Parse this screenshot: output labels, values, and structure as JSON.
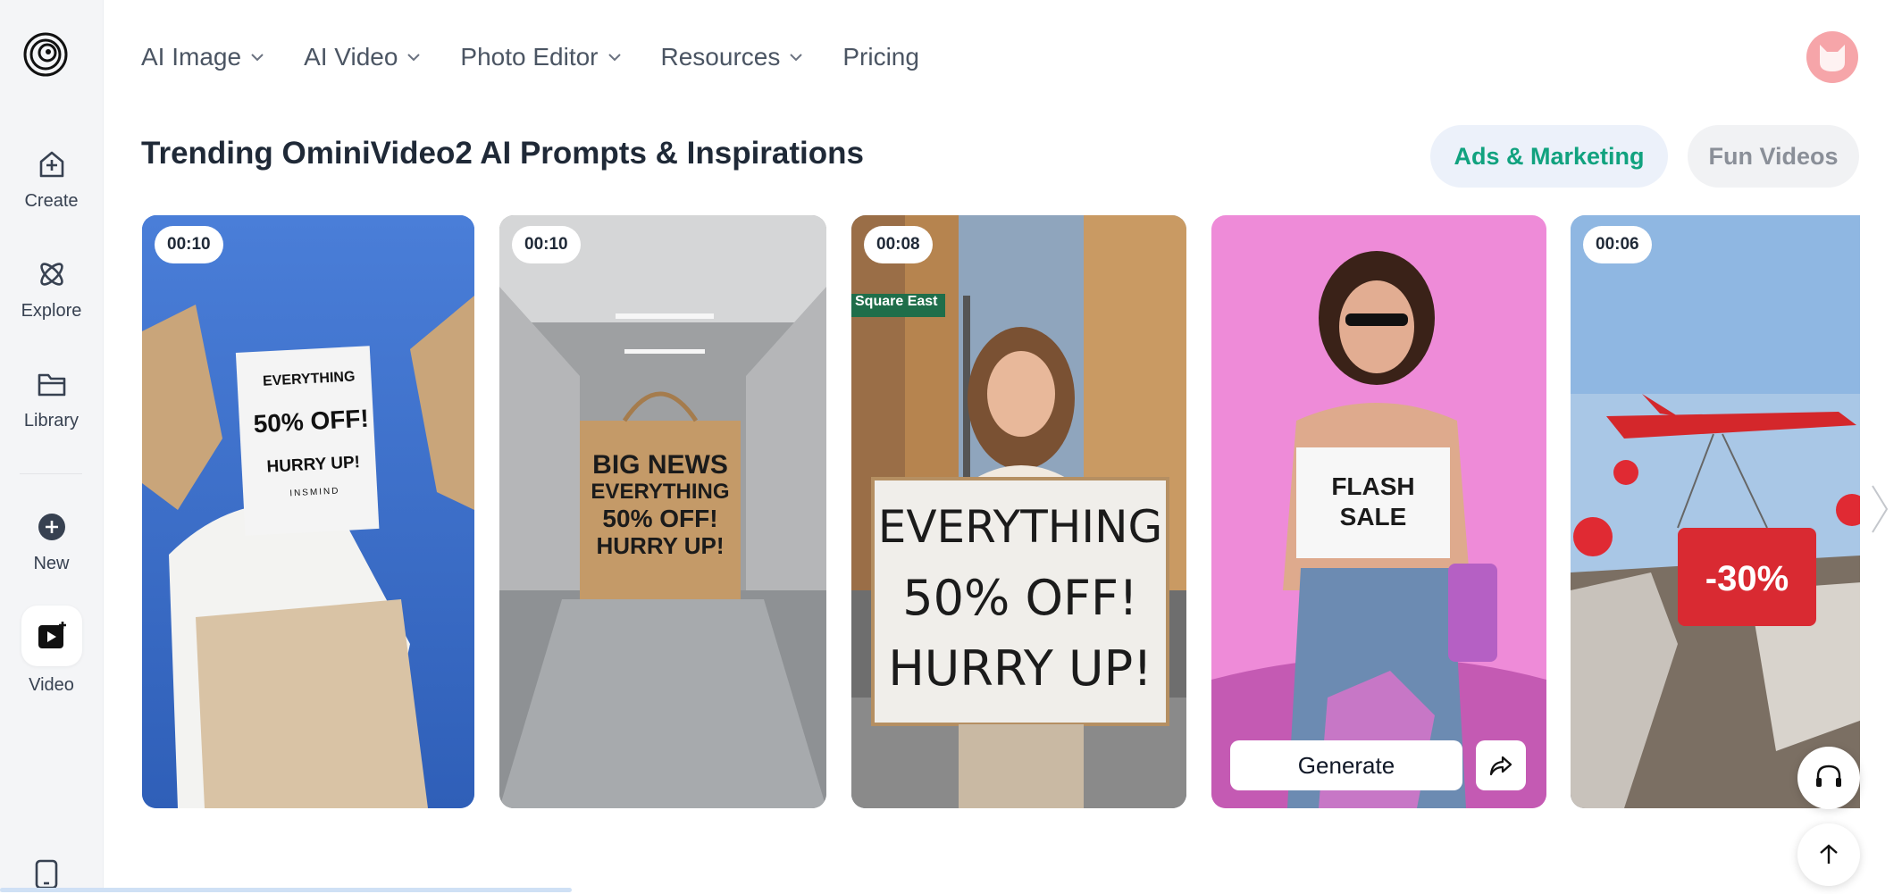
{
  "nav": {
    "items": [
      {
        "label": "AI Image",
        "has_dropdown": true
      },
      {
        "label": "AI Video",
        "has_dropdown": true
      },
      {
        "label": "Photo Editor",
        "has_dropdown": true
      },
      {
        "label": "Resources",
        "has_dropdown": true
      },
      {
        "label": "Pricing",
        "has_dropdown": false
      }
    ]
  },
  "sidebar": {
    "logo_icon": "spiral-logo-icon",
    "items": [
      {
        "label": "Create",
        "icon": "create-icon"
      },
      {
        "label": "Explore",
        "icon": "explore-icon"
      },
      {
        "label": "Library",
        "icon": "folder-icon"
      },
      {
        "label": "New",
        "icon": "plus-circle-icon"
      },
      {
        "label": "Video",
        "icon": "video-icon",
        "active": true
      }
    ],
    "bottom_icon": "mobile-icon"
  },
  "header": {
    "title": "Trending OminiVideo2 AI Prompts & Inspirations",
    "tabs": [
      {
        "label": "Ads & Marketing",
        "active": true
      },
      {
        "label": "Fun Videos",
        "active": false
      }
    ]
  },
  "cards": [
    {
      "duration": "00:10",
      "sign_text": [
        "EVERYTHING",
        "50% OFF!",
        "HURRY UP!",
        "INSMIND"
      ]
    },
    {
      "duration": "00:10",
      "sign_text": [
        "BIG NEWS",
        "EVERYTHING",
        "50% OFF!",
        "HURRY UP!"
      ]
    },
    {
      "duration": "00:08",
      "street_sign": "Square East",
      "sign_text": [
        "EVERYTHING",
        "50% OFF!",
        "HURRY UP!"
      ]
    },
    {
      "duration": "",
      "sign_text": [
        "FLASH",
        "SALE"
      ],
      "generate_label": "Generate",
      "hovered": true
    },
    {
      "duration": "00:06",
      "sign_text": [
        "-30%"
      ]
    }
  ],
  "colors": {
    "accent": "#11a27f",
    "sidebar_bg": "#f4f5f7",
    "active_tab_bg": "#ecf1fa",
    "avatar_bg": "#f6a5a9"
  },
  "floating": {
    "support_icon": "headset-icon",
    "top_icon": "arrow-up-icon"
  }
}
